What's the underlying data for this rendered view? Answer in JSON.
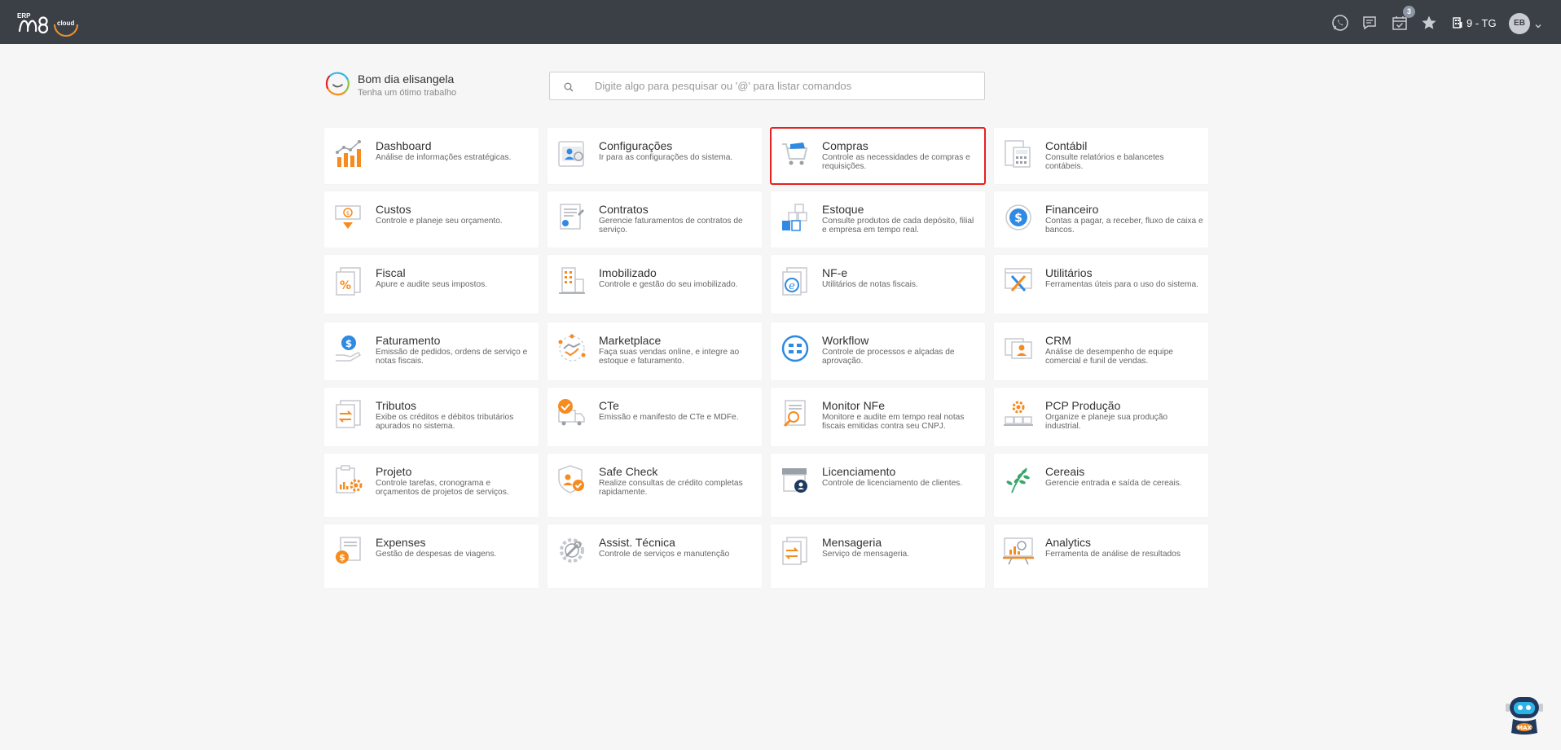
{
  "header": {
    "logo_erp": "ERP",
    "logo_brand": "m8",
    "logo_suffix": "cloud",
    "notification_count": "3",
    "company": "9 - TG",
    "user_initials": "EB"
  },
  "greeting": {
    "title": "Bom dia elisangela",
    "subtitle": "Tenha um ótimo trabalho"
  },
  "search": {
    "placeholder": "Digite algo para pesquisar ou '@' para listar comandos"
  },
  "accent_color": "#f68b1f",
  "selected_border_color": "#e5201f",
  "modules": [
    {
      "title": "Dashboard",
      "desc": "Análise de informações estratégicas.",
      "icon": "bar-chart-icon"
    },
    {
      "title": "Configurações",
      "desc": "Ir para as configurações do sistema.",
      "icon": "settings-user-icon"
    },
    {
      "title": "Compras",
      "desc": "Controle as necessidades de compras e requisições.",
      "icon": "shopping-cart-icon",
      "selected": true
    },
    {
      "title": "Contábil",
      "desc": "Consulte relatórios e balancetes contábeis.",
      "icon": "calculator-icon"
    },
    {
      "title": "Custos",
      "desc": "Controle e planeje seu orçamento.",
      "icon": "money-icon"
    },
    {
      "title": "Contratos",
      "desc": "Gerencie faturamentos de contratos de serviço.",
      "icon": "contract-icon"
    },
    {
      "title": "Estoque",
      "desc": "Consulte produtos de cada depósito, filial e empresa em tempo real.",
      "icon": "warehouse-icon"
    },
    {
      "title": "Financeiro",
      "desc": "Contas a pagar, a receber, fluxo de caixa e bancos.",
      "icon": "dollar-coin-icon"
    },
    {
      "title": "Fiscal",
      "desc": "Apure e audite seus impostos.",
      "icon": "percent-document-icon"
    },
    {
      "title": "Imobilizado",
      "desc": "Controle e gestão do seu imobilizado.",
      "icon": "building-icon"
    },
    {
      "title": "NF-e",
      "desc": "Utilitários de notas fiscais.",
      "icon": "e-document-icon"
    },
    {
      "title": "Utilitários",
      "desc": "Ferramentas úteis para o uso do sistema.",
      "icon": "tools-icon"
    },
    {
      "title": "Faturamento",
      "desc": "Emissão de pedidos, ordens de serviço e notas fiscais.",
      "icon": "hand-dollar-icon"
    },
    {
      "title": "Marketplace",
      "desc": "Faça suas vendas online, e integre ao estoque e faturamento.",
      "icon": "handshake-icon"
    },
    {
      "title": "Workflow",
      "desc": "Controle de processos e alçadas de aprovação.",
      "icon": "workflow-icon"
    },
    {
      "title": "CRM",
      "desc": "Análise de desempenho de equipe comercial e funil de vendas.",
      "icon": "contacts-icon"
    },
    {
      "title": "Tributos",
      "desc": "Exibe os créditos e débitos tributários apurados no sistema.",
      "icon": "exchange-document-icon"
    },
    {
      "title": "CTe",
      "desc": "Emissão e manifesto de CTe e MDFe.",
      "icon": "truck-check-icon"
    },
    {
      "title": "Monitor NFe",
      "desc": "Monitore e audite em tempo real notas fiscais emitidas contra seu CNPJ.",
      "icon": "magnifier-document-icon"
    },
    {
      "title": "PCP Produção",
      "desc": "Organize e planeje sua produção industrial.",
      "icon": "production-gear-icon"
    },
    {
      "title": "Projeto",
      "desc": "Controle tarefas, cronograma e orçamentos de projetos de serviços.",
      "icon": "clipboard-gear-icon"
    },
    {
      "title": "Safe Check",
      "desc": "Realize consultas de crédito completas rapidamente.",
      "icon": "shield-check-icon"
    },
    {
      "title": "Licenciamento",
      "desc": "Controle de licenciamento de clientes.",
      "icon": "license-icon"
    },
    {
      "title": "Cereais",
      "desc": "Gerencie entrada e saída de cereais.",
      "icon": "grain-icon"
    },
    {
      "title": "Expenses",
      "desc": "Gestão de despesas de viagens.",
      "icon": "expense-icon"
    },
    {
      "title": "Assist. Técnica",
      "desc": "Controle de serviços e manutenção",
      "icon": "wrench-gear-icon"
    },
    {
      "title": "Mensageria",
      "desc": "Serviço de mensageria.",
      "icon": "messaging-icon"
    },
    {
      "title": "Analytics",
      "desc": "Ferramenta de análise de resultados",
      "icon": "analytics-board-icon"
    }
  ]
}
